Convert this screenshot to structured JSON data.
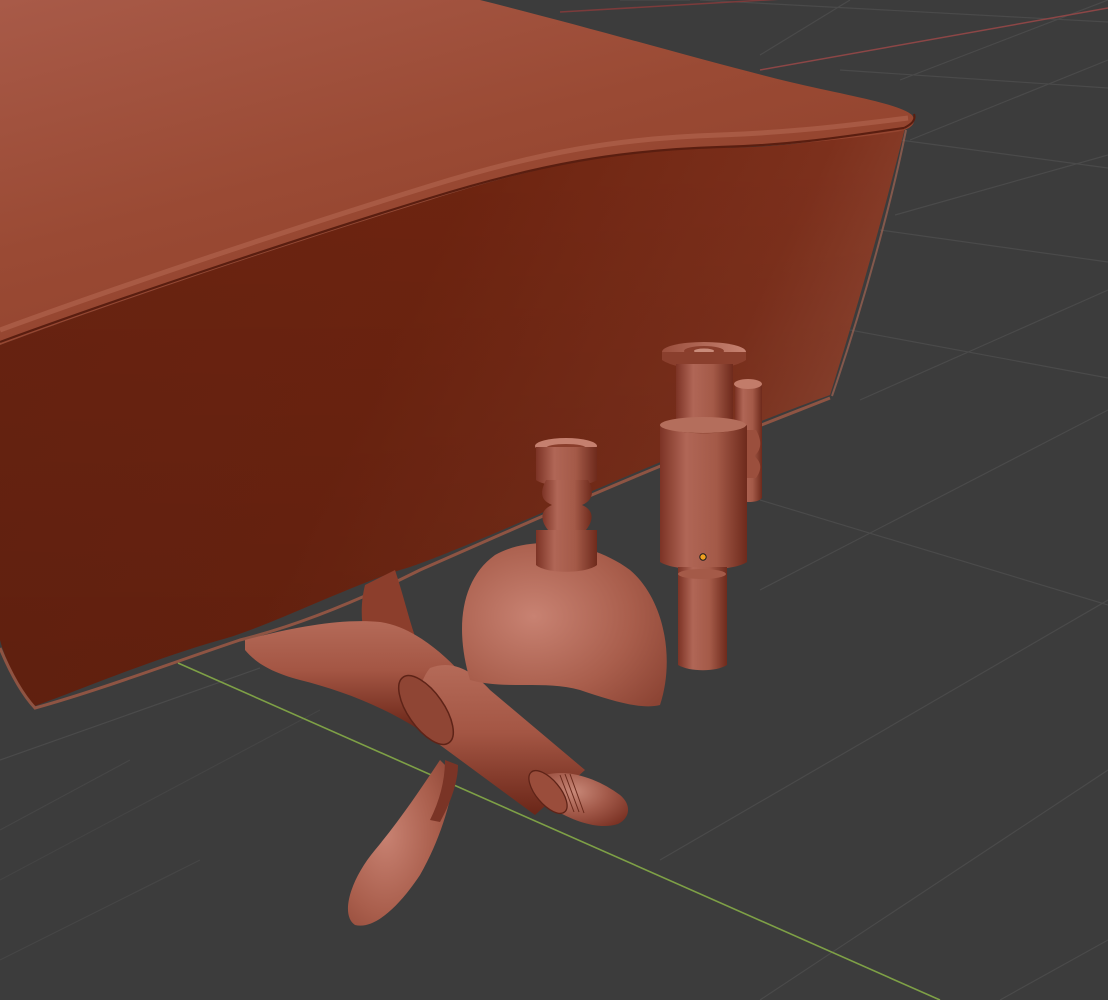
{
  "viewport": {
    "name": "3d-viewport",
    "background_color": "#3c3c3c",
    "grid_line_color": "#4b4b4b",
    "x_axis_color": "#8c4646",
    "y_axis_color": "#7fa446"
  },
  "model": {
    "name": "boat-hull",
    "material_color": "#8a3b24",
    "parts": [
      "hull",
      "propeller",
      "propeller-shaft",
      "rudder-post",
      "stern-fitting",
      "stern-fitting-rear"
    ]
  },
  "selection": {
    "origin_marker_color": "#f0a020"
  }
}
